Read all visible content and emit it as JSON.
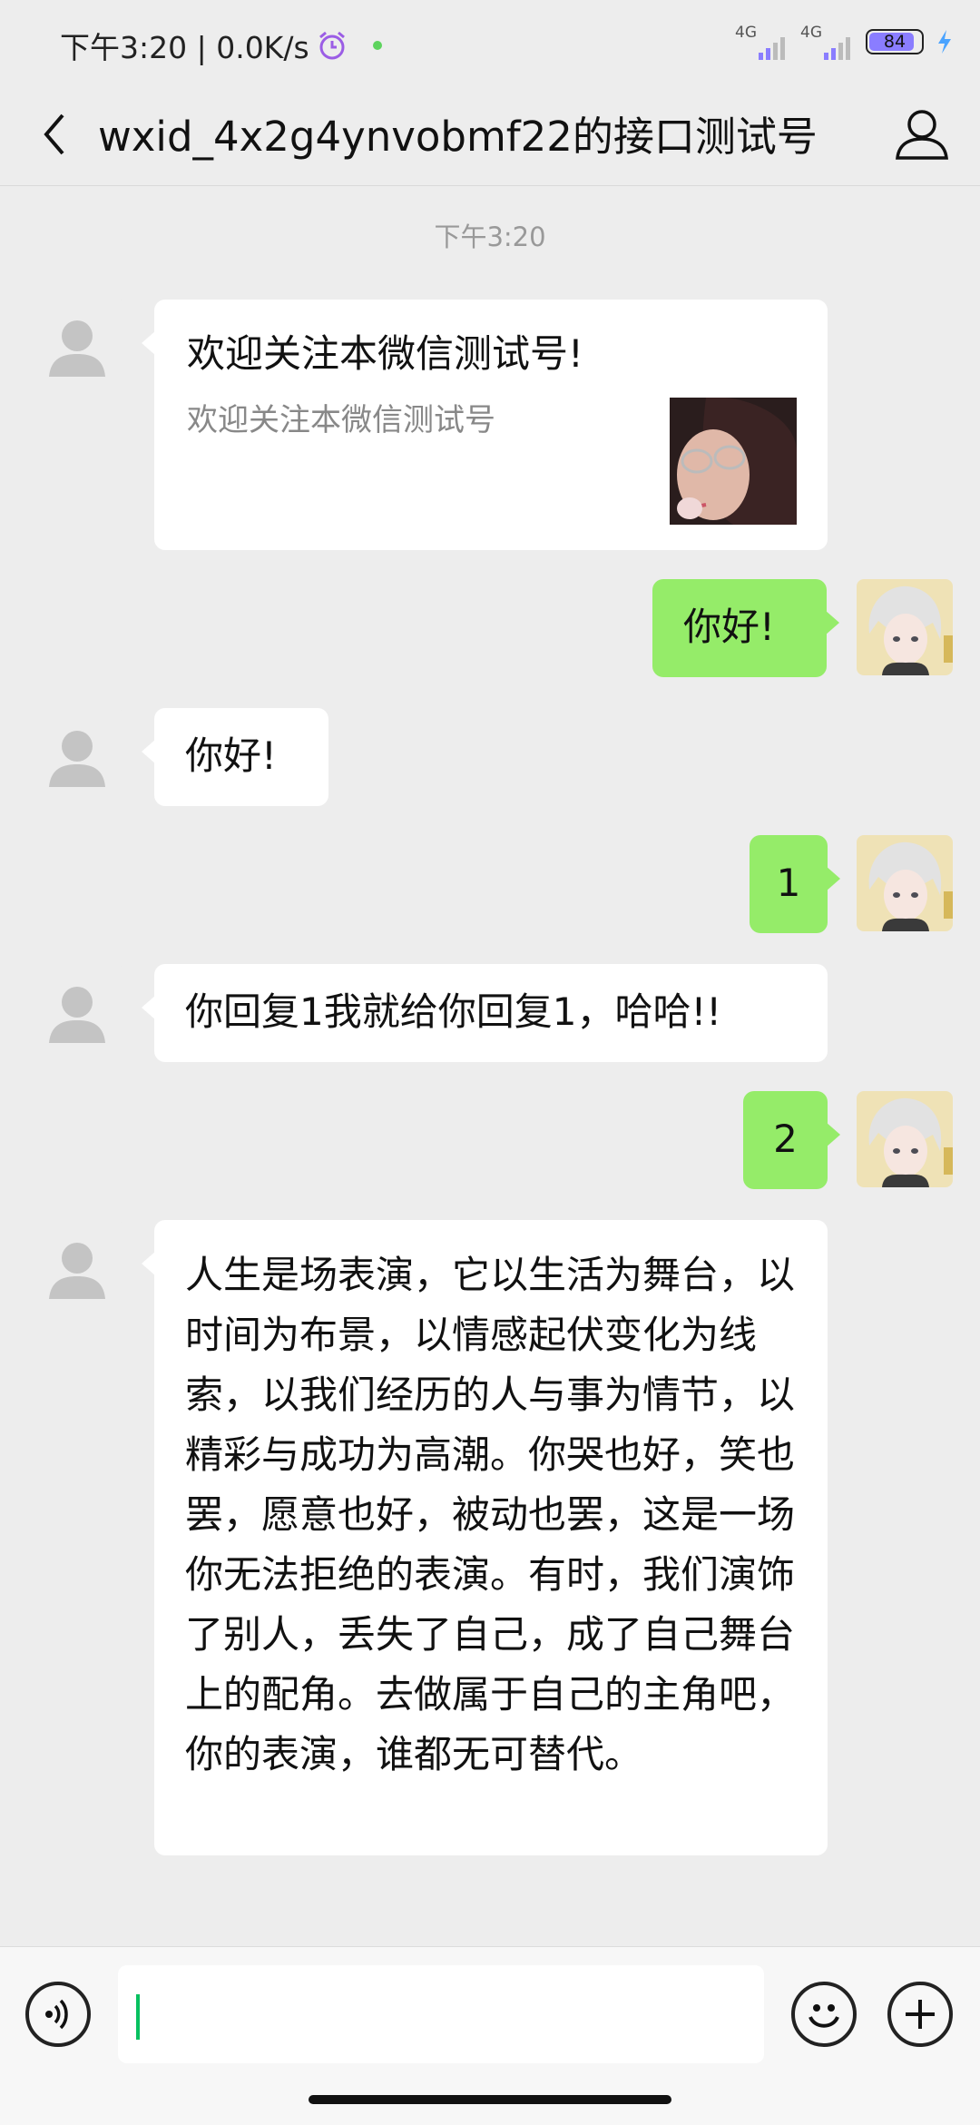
{
  "status_bar": {
    "time_speed": "下午3:20 | 0.0K/s",
    "network1": "4G",
    "network2": "4G",
    "battery": "84"
  },
  "header": {
    "title": "wxid_4x2g4ynvobmf22的接口测试号"
  },
  "chat": {
    "timestamp": "下午3:20",
    "card": {
      "title": "欢迎关注本微信测试号!",
      "description": "欢迎关注本微信测试号"
    },
    "messages": [
      "你好!",
      "你好!",
      "1",
      "你回复1我就给你回复1，哈哈!!",
      "2",
      "人生是场表演，它以生活为舞台，以时间为布景，以情感起伏变化为线索，以我们经历的人与事为情节，以精彩与成功为高潮。你哭也好，笑也罢，愿意也好，被动也罢，这是一场你无法拒绝的表演。有时，我们演饰了别人，丢失了自己，成了自己舞台上的配角。去做属于自己的主角吧，你的表演，谁都无可替代。"
    ]
  },
  "input": {
    "value": ""
  },
  "colors": {
    "outgoing_bubble": "#95ec69",
    "incoming_bubble": "#ffffff",
    "background": "#ededed"
  }
}
